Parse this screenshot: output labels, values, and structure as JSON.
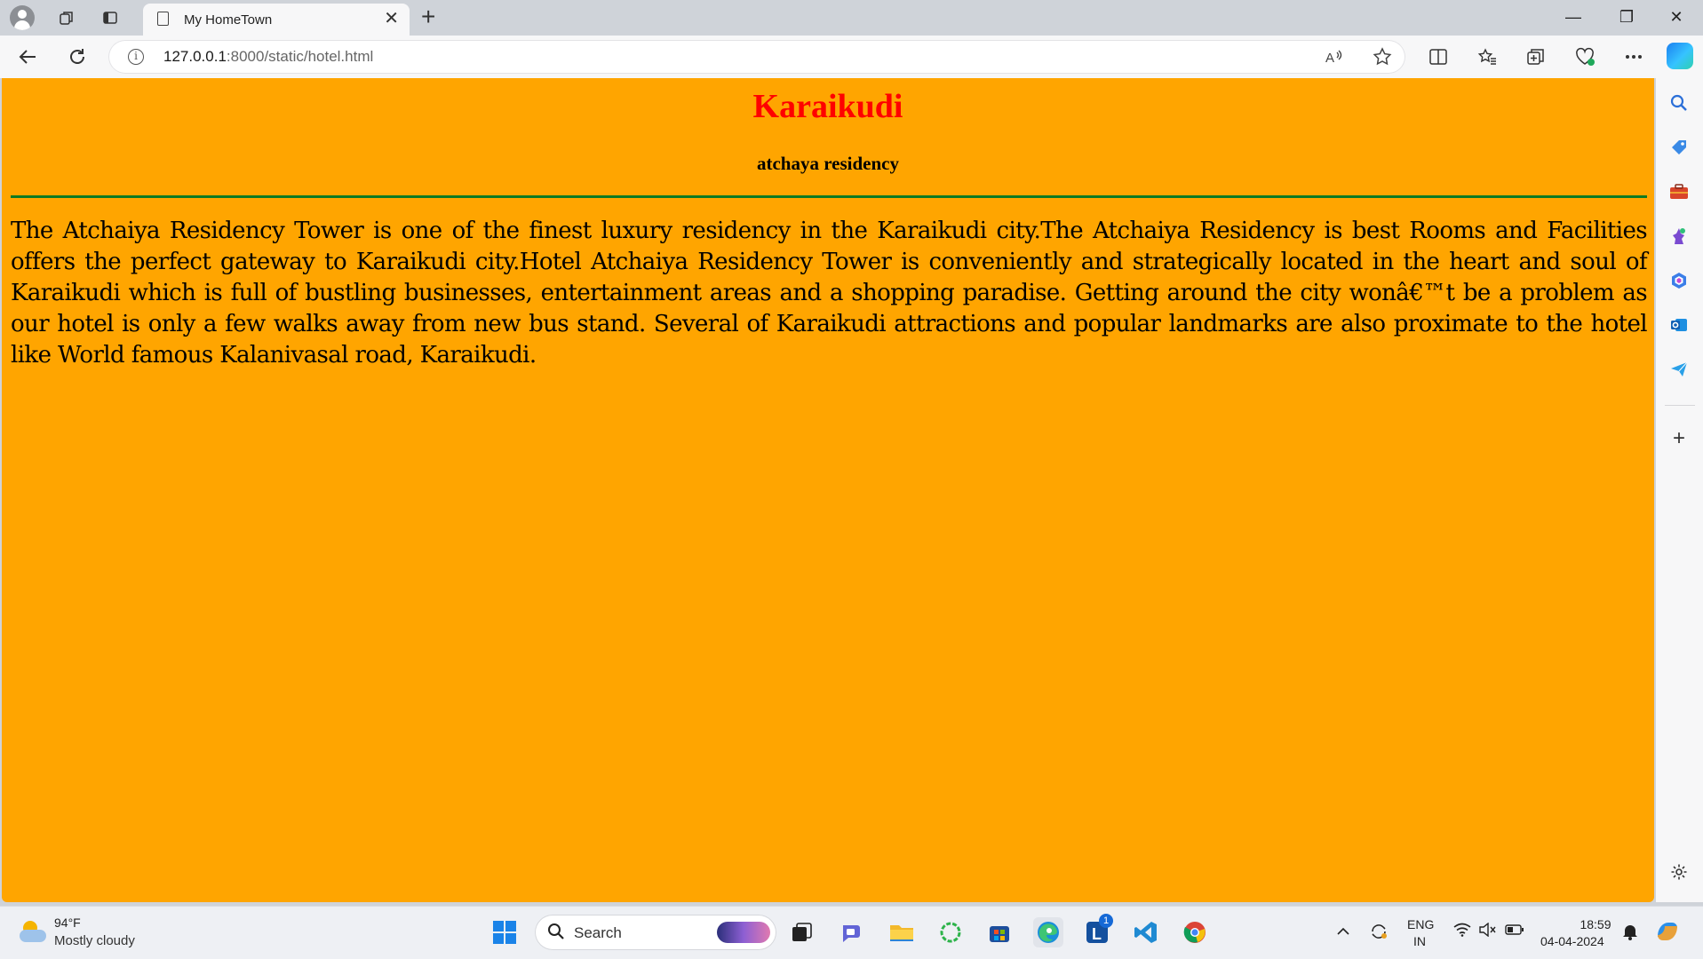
{
  "browser": {
    "tab_title": "My HomeTown",
    "tab_close": "✕",
    "new_tab": "+",
    "url_host": "127.0.0.1",
    "url_rest": ":8000/static/hotel.html",
    "info_glyph": "i",
    "icons": [
      "profile-icon",
      "workspaces-icon",
      "tab-actions-icon",
      "page-icon",
      "back-icon",
      "refresh-icon",
      "read-aloud-icon",
      "favorite-star-icon",
      "split-screen-icon",
      "favorites-icon",
      "collections-icon",
      "browser-essentials-icon",
      "more-icon",
      "copilot-icon"
    ],
    "window_controls": {
      "minimize": "—",
      "restore": "❐",
      "close": "✕"
    }
  },
  "page": {
    "title": "Karaikudi",
    "subtitle": "atchaya residency",
    "body": "The Atchaiya Residency Tower is one of the finest luxury residency in the Karaikudi city.The Atchaiya Residency is best Rooms and Facilities offers the perfect gateway to Karaikudi city.Hotel Atchaiya Residency Tower is conveniently and strategically located in the heart and soul of Karaikudi which is full of bustling businesses, entertainment areas and a shopping paradise. Getting around the city wonâ€™t be a problem as our hotel is only a few walks away from new bus stand. Several of Karaikudi attractions and popular landmarks are also proximate to the hotel like World famous Kalanivasal road, Karaikudi.",
    "background_color": "#ffa500",
    "title_color": "#ff0000",
    "divider_color": "#0d7a22"
  },
  "sidebar": {
    "add_glyph": "+",
    "icons": [
      "search-icon",
      "shopping-tag-icon",
      "tools-icon",
      "games-icon",
      "microsoft-365-icon",
      "outlook-icon",
      "send-icon",
      "add-icon",
      "settings-icon"
    ]
  },
  "taskbar": {
    "weather_temp": "94°F",
    "weather_desc": "Mostly cloudy",
    "search_placeholder": "Search",
    "app_badge": "1",
    "language_line1": "ENG",
    "language_line2": "IN",
    "time": "18:59",
    "date": "04-04-2024",
    "icons": [
      "weather-icon",
      "windows-start-icon",
      "search-icon",
      "task-view-icon",
      "teams-chat-icon",
      "file-explorer-icon",
      "app-icon",
      "store-icon",
      "edge-icon",
      "l-app-icon",
      "vscode-icon",
      "chrome-icon",
      "chevron-up-icon",
      "sync-icon",
      "wifi-icon",
      "mute-icon",
      "battery-icon",
      "notification-icon",
      "copilot-icon"
    ]
  }
}
